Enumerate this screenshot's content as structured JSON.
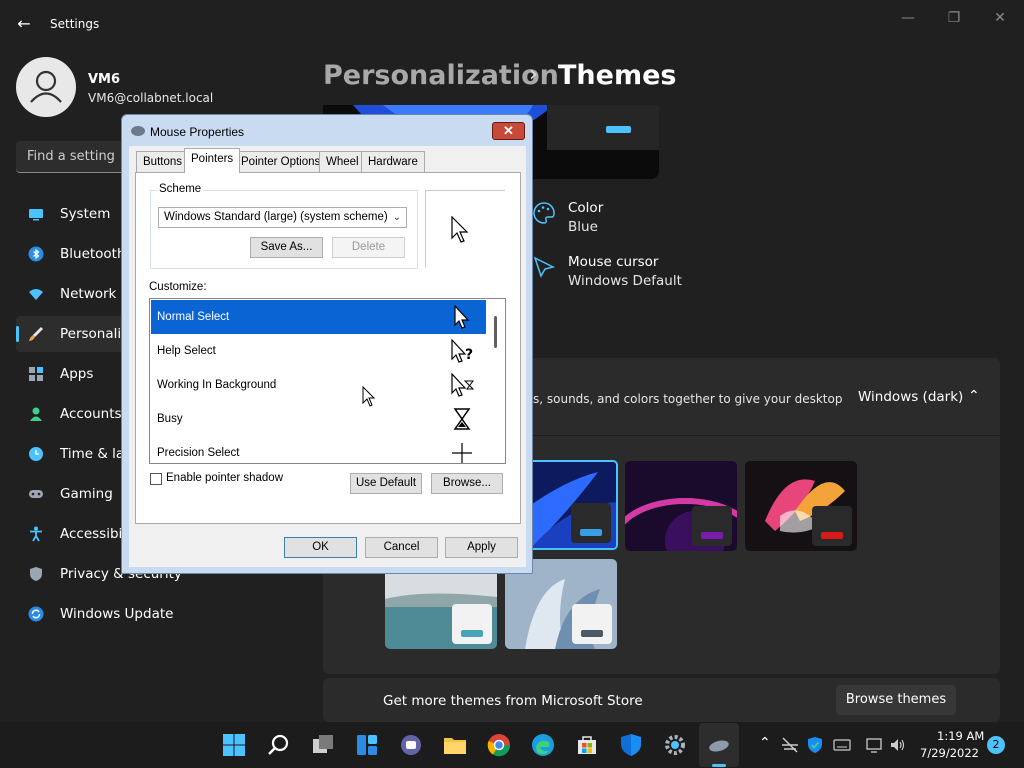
{
  "titlebar": {
    "title": "Settings",
    "back_icon": "back-arrow-icon"
  },
  "user": {
    "name": "VM6",
    "email": "VM6@collabnet.local"
  },
  "search": {
    "placeholder": "Find a setting"
  },
  "sidebar": {
    "items": [
      {
        "label": "System",
        "icon": "system-icon",
        "color": "#4cc2ff"
      },
      {
        "label": "Bluetooth",
        "icon": "bluetooth-icon",
        "color": "#2b8ce8"
      },
      {
        "label": "Network &",
        "icon": "network-icon",
        "color": "#4cc2ff"
      },
      {
        "label": "Personaliz",
        "icon": "personalization-icon",
        "color": "#f0a24a",
        "active": true
      },
      {
        "label": "Apps",
        "icon": "apps-icon",
        "color": "#9aa6b2"
      },
      {
        "label": "Accounts",
        "icon": "accounts-icon",
        "color": "#3fcf8e"
      },
      {
        "label": "Time & la",
        "icon": "time-icon",
        "color": "#4cc2ff"
      },
      {
        "label": "Gaming",
        "icon": "gaming-icon",
        "color": "#9aa6b2"
      },
      {
        "label": "Accessibil",
        "icon": "accessibility-icon",
        "color": "#4cc2ff"
      },
      {
        "label": "Privacy & security",
        "icon": "privacy-shield-icon",
        "color": "#9aa6b2"
      },
      {
        "label": "Windows Update",
        "icon": "update-icon",
        "color": "#2b8ce8"
      }
    ]
  },
  "breadcrumb": {
    "parent": "Personalization",
    "separator": "›",
    "current": "Themes"
  },
  "settings": {
    "color": {
      "title": "Color",
      "value": "Blue"
    },
    "cursor": {
      "title": "Mouse cursor",
      "value": "Windows Default"
    }
  },
  "themes_card": {
    "description": "s, sounds, and colors together to give your desktop",
    "current": "Windows (dark)"
  },
  "store": {
    "text": "Get more themes from Microsoft Store",
    "button": "Browse themes"
  },
  "dialog": {
    "title": "Mouse Properties",
    "tabs": [
      "Buttons",
      "Pointers",
      "Pointer Options",
      "Wheel",
      "Hardware"
    ],
    "selected_tab": "Pointers",
    "scheme_label": "Scheme",
    "scheme_value": "Windows Standard (large) (system scheme)",
    "save_as": "Save As...",
    "delete": "Delete",
    "customize_label": "Customize:",
    "list": [
      {
        "label": "Normal Select",
        "selected": true
      },
      {
        "label": "Help Select"
      },
      {
        "label": "Working In Background"
      },
      {
        "label": "Busy"
      },
      {
        "label": "Precision Select"
      }
    ],
    "shadow_label": "Enable pointer shadow",
    "shadow_checked": false,
    "use_default": "Use Default",
    "browse": "Browse...",
    "ok": "OK",
    "cancel": "Cancel",
    "apply": "Apply"
  },
  "taskbar": {
    "time": "1:19 AM",
    "date": "7/29/2022",
    "notification_count": "2"
  }
}
